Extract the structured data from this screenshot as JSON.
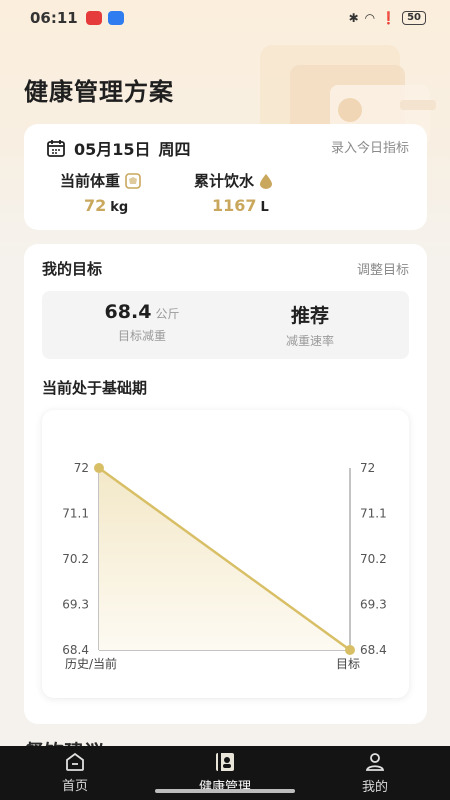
{
  "status_bar": {
    "time": "06:11",
    "battery": "50"
  },
  "page": {
    "title": "健康管理方案"
  },
  "today": {
    "date": "05月15日",
    "weekday": "周四",
    "record_link": "录入今日指标",
    "weight": {
      "label": "当前体重",
      "value": "72",
      "unit": "kg"
    },
    "water": {
      "label": "累计饮水",
      "value": "1167",
      "unit": "L"
    }
  },
  "goal": {
    "title": "我的目标",
    "adjust_link": "调整目标",
    "target": {
      "value": "68.4",
      "unit": "公斤",
      "label": "目标减重"
    },
    "rate": {
      "value": "推荐",
      "label": "减重速率"
    }
  },
  "phase": {
    "title": "当前处于基础期"
  },
  "chart_data": {
    "type": "area",
    "x": [
      "历史/当前",
      "目标"
    ],
    "values": [
      72,
      68.4
    ],
    "y_ticks": [
      "72",
      "71.1",
      "70.2",
      "69.3",
      "68.4"
    ],
    "ylim": [
      68.4,
      72
    ],
    "colors": {
      "line": "#d8bf66",
      "fill_top": "#f3e8c8",
      "axis": "#888888"
    }
  },
  "next_section": {
    "title": "餐饮建议"
  },
  "tabbar": {
    "items": [
      {
        "label": "首页",
        "icon": "home-icon"
      },
      {
        "label": "健康管理",
        "icon": "health-book-icon"
      },
      {
        "label": "我的",
        "icon": "profile-icon"
      }
    ],
    "active": "健康管理"
  }
}
